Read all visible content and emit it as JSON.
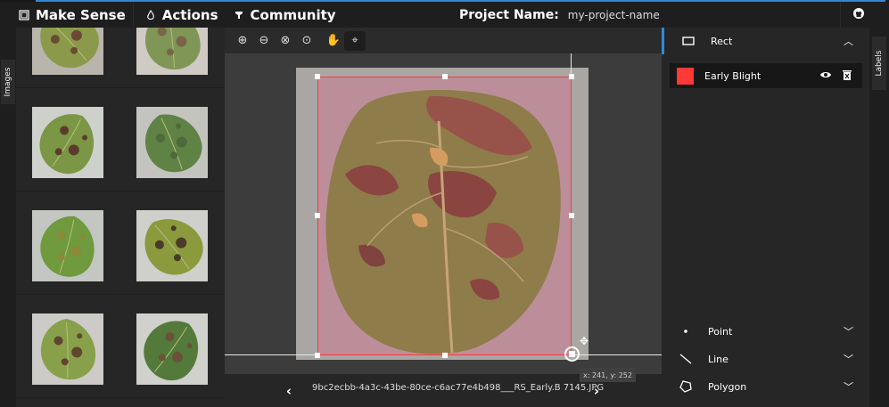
{
  "nav": {
    "brand": "Make Sense",
    "actions": "Actions",
    "community": "Community",
    "project_label": "Project Name:",
    "project_value": "my-project-name"
  },
  "left_tab": {
    "label": "Images"
  },
  "right_tab": {
    "label": "Labels"
  },
  "thumbnails": [
    {
      "leaf_color": "#8a9a4a",
      "spot_color": "#6b4a34",
      "bg": "#b9b5ad"
    },
    {
      "leaf_color": "#7f9656",
      "spot_color": "#7a6548",
      "bg": "#cfcac4"
    },
    {
      "leaf_color": "#7b9645",
      "spot_color": "#5b3c2a",
      "bg": "#cdd0cb"
    },
    {
      "leaf_color": "#5f8245",
      "spot_color": "#4d6a3a",
      "bg": "#c3c3bf"
    },
    {
      "leaf_color": "#6f9a3d",
      "spot_color": "#8a8a3a",
      "bg": "#c4c6c2"
    },
    {
      "leaf_color": "#8a9a3c",
      "spot_color": "#4a3a28",
      "bg": "#cfcfcb"
    },
    {
      "leaf_color": "#88a04a",
      "spot_color": "#5e4630",
      "bg": "#cdcbc7"
    },
    {
      "leaf_color": "#537a3a",
      "spot_color": "#6a5238",
      "bg": "#d0d0cc"
    }
  ],
  "toolbar": {
    "tools": [
      "zoom-in",
      "zoom-out",
      "zoom-fit",
      "zoom-max",
      "pan",
      "crosshair"
    ]
  },
  "bottom": {
    "filename": "9bc2ecbb-4a3c-43be-80ce-c6ac77e4b498___RS_Early.B 7145.JPG",
    "coords": "x: 241, y: 252"
  },
  "label_panel": {
    "rect": "Rect",
    "label_name": "Early Blight",
    "label_color": "#ff3838",
    "point": "Point",
    "line": "Line",
    "polygon": "Polygon"
  },
  "colors": {
    "accent": "#2f88d6",
    "bbox": "#ff3838"
  }
}
